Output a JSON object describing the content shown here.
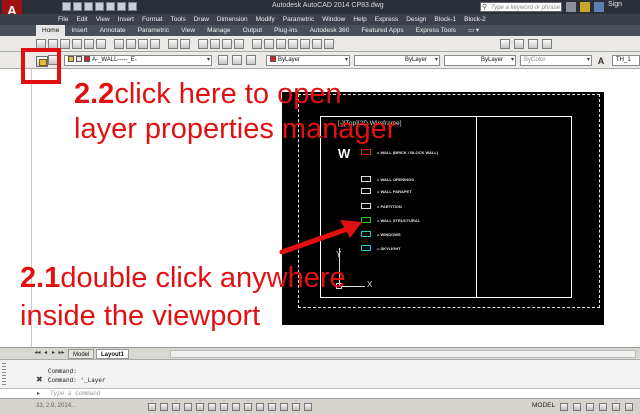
{
  "titlebar": {
    "file_title": "Autodesk AutoCAD 2014    CP83.dwg",
    "search_placeholder": "Type a keyword or phrase",
    "sign_in": "Sign"
  },
  "menubar": [
    "File",
    "Edit",
    "View",
    "Insert",
    "Format",
    "Tools",
    "Draw",
    "Dimension",
    "Modify",
    "Parametric",
    "Window",
    "Help",
    "Express",
    "Design",
    "Block-1",
    "Block-2"
  ],
  "ribbon_tabs": [
    "Home",
    "Insert",
    "Annotate",
    "Parametric",
    "View",
    "Manage",
    "Output",
    "Plug-ins",
    "Autodesk 360",
    "Featured Apps",
    "Express Tools",
    "▭ ▾"
  ],
  "active_ribbon_tab": "Home",
  "toolbar2": {
    "layer_combo": "A-_WALL-----_E-",
    "color_combo": "ByLayer",
    "linetype_combo": "ByLayer",
    "lineweight_combo": "ByLayer",
    "plotstyle_combo": "ByColor",
    "textstyle_combo": "TH_1",
    "textstyle_icon": "A"
  },
  "viewport": {
    "label": "[-][Top][2D Wireframe]",
    "legend_title": "W",
    "legend_rows": [
      {
        "text": "= WALL (BRICK / BLOCK WALL)",
        "color": "#e02020"
      },
      {
        "text": "= WALL OPENINGS",
        "color": "#dddddd"
      },
      {
        "text": "= WALL PARAPET",
        "color": "#dddddd"
      },
      {
        "text": "= PARTITION",
        "color": "#dddddd"
      },
      {
        "text": "= WALL STRUCTURAL",
        "color": "#22cc22"
      },
      {
        "text": "= WINDOWS",
        "color": "#22cccc"
      },
      {
        "text": "= SKYLIGHT",
        "color": "#22cccc"
      }
    ],
    "ucs_y": "Y",
    "ucs_x": "X"
  },
  "annotations": {
    "step22_num": "2.2",
    "step22_line1": "click here to open",
    "step22_line2": "layer properties manager",
    "step21_num": "2.1",
    "step21_line1": "double click anywhere",
    "step21_line2": "inside the viewport",
    "color": "#e11111"
  },
  "layout_tabs": {
    "nav": [
      "◂◂",
      "◂",
      "▸",
      "▸▸"
    ],
    "model": "Model",
    "layout1": "Layout1"
  },
  "command_line": {
    "history_1": "Command:",
    "history_2": "Command: '_Layer",
    "input_placeholder": "Type a command"
  },
  "statusbar": {
    "coords": "33, 2.9, 2014...",
    "model": "MODEL"
  }
}
